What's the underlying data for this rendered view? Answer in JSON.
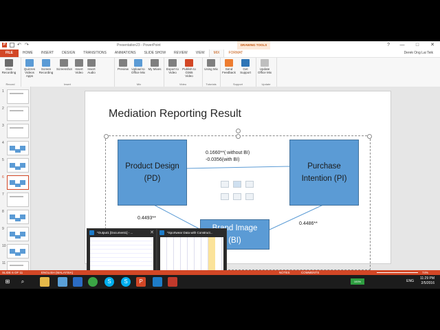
{
  "window": {
    "title": "Presentation23 - PowerPoint",
    "drawing_tools_label": "DRAWING TOOLS",
    "user_name": "Derek Ong Lai Teik",
    "controls": [
      "?",
      "—",
      "□",
      "✕"
    ]
  },
  "tabs": [
    "FILE",
    "HOME",
    "INSERT",
    "DESIGN",
    "TRANSITIONS",
    "ANIMATIONS",
    "SLIDE SHOW",
    "REVIEW",
    "VIEW",
    "MIX",
    "FORMAT"
  ],
  "ribbon": {
    "groups": [
      {
        "label": "Record",
        "buttons": [
          {
            "label": "Slide Recording",
            "icon": "slide-recording-icon",
            "color": "#6b6b6b"
          }
        ]
      },
      {
        "label": "Insert",
        "buttons": [
          {
            "label": "Quizzes Videos Apps",
            "icon": "quiz-icon",
            "color": "#5b9bd5"
          },
          {
            "label": "Screen Recording",
            "icon": "screen-recording-icon",
            "color": "#5b9bd5"
          },
          {
            "label": "Screenshot",
            "icon": "screenshot-icon",
            "color": "#7f7f7f"
          },
          {
            "label": "Insert Video",
            "icon": "insert-video-icon",
            "color": "#7f7f7f"
          },
          {
            "label": "Insert Audio",
            "icon": "insert-audio-icon",
            "color": "#7f7f7f"
          }
        ]
      },
      {
        "label": "Mix",
        "buttons": [
          {
            "label": "Preview",
            "icon": "preview-icon",
            "color": "#7f7f7f"
          },
          {
            "label": "Upload to Office Mix",
            "icon": "upload-icon",
            "color": "#5b9bd5"
          },
          {
            "label": "My Mixes",
            "icon": "my-mixes-icon",
            "color": "#7f7f7f"
          }
        ]
      },
      {
        "label": "Video",
        "buttons": [
          {
            "label": "Export to Video",
            "icon": "export-video-icon",
            "color": "#7f7f7f"
          },
          {
            "label": "Publish to O365 Video",
            "icon": "publish-icon",
            "color": "#d24726"
          }
        ]
      },
      {
        "label": "Tutorials",
        "buttons": [
          {
            "label": "Using Mix",
            "icon": "using-mix-icon",
            "color": "#7f7f7f"
          }
        ]
      },
      {
        "label": "Support",
        "buttons": [
          {
            "label": "Send Feedback",
            "icon": "feedback-icon",
            "color": "#ed7d31"
          },
          {
            "label": "Get Support",
            "icon": "support-icon",
            "color": "#2e75b6"
          }
        ]
      },
      {
        "label": "Update",
        "buttons": [
          {
            "label": "Update Office Mix",
            "icon": "update-icon",
            "color": "#bfbfbf"
          }
        ]
      }
    ]
  },
  "thumbnails": [
    {
      "num": "1"
    },
    {
      "num": "2"
    },
    {
      "num": "3"
    },
    {
      "num": "4"
    },
    {
      "num": "5"
    },
    {
      "num": "6",
      "active": true
    },
    {
      "num": "7"
    },
    {
      "num": "8"
    },
    {
      "num": "9"
    },
    {
      "num": "10"
    },
    {
      "num": "11"
    }
  ],
  "slide": {
    "title": "Mediation Reporting Result",
    "pd_line1": "Product Design",
    "pd_line2": "(PD)",
    "pi_line1": "Purchase",
    "pi_line2": "Intention (PI)",
    "bi_line1": "Brand Image",
    "bi_line2": "(BI)",
    "coef_top_line1": "0.1660**( without BI)",
    "coef_top_line2": "-0.0356(with BI)",
    "coef_left": "0.4493**",
    "coef_right": "0.4486**",
    "box_color": "#5b9bd5"
  },
  "statusbar": {
    "slide_info": "SLIDE 6 OF 11",
    "language": "ENGLISH (MALAYSIA)",
    "notes": "NOTES",
    "comments": "COMMENTS",
    "zoom": "74%"
  },
  "previews": [
    {
      "title": "*Output1 [Document1] - ..."
    },
    {
      "title": "*Sportwear Data with Construct..."
    }
  ],
  "taskbar": {
    "battery": "100%",
    "lang": "ENG",
    "time": "11:29 PM",
    "date": "2/5/2016"
  }
}
